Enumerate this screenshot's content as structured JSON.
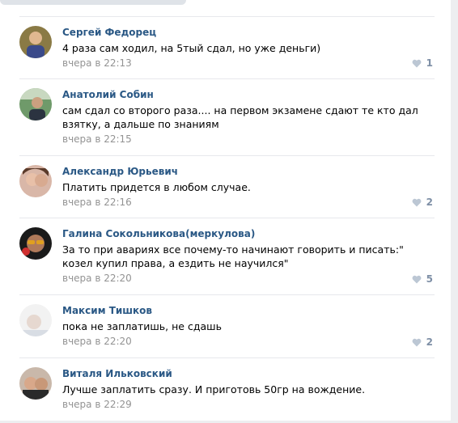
{
  "comments": [
    {
      "author": "Сергей Федорец",
      "text": "4 раза сам ходил, на 5тый сдал, но уже деньги)",
      "time": "вчера в 22:13",
      "likes": "1"
    },
    {
      "author": "Анатолий Собин",
      "text": "сам сдал со второго раза.... на первом экзамене сдают те кто дал взятку, а дальше по знаниям",
      "time": "вчера в 22:15",
      "likes": ""
    },
    {
      "author": "Александр Юрьевич",
      "text": "Платить придется в любом случае.",
      "time": "вчера в 22:16",
      "likes": "2"
    },
    {
      "author": "Галина Сокольникова(меркулова)",
      "text": "За то при авариях все почему-то начинают говорить и писать:\" козел купил права, а ездить не научился\"",
      "time": "вчера в 22:20",
      "likes": "5"
    },
    {
      "author": "Максим Тишков",
      "text": "пока не заплатишь, не сдашь",
      "time": "вчера в 22:20",
      "likes": "2"
    },
    {
      "author": "Виталя Ильковский",
      "text": "Лучше заплатить сразу. И приготовь 50гр на вождение.",
      "time": "вчера в 22:29",
      "likes": ""
    }
  ],
  "icons": {
    "like": "heart-icon",
    "avatar": "user-avatar"
  },
  "colors": {
    "author": "#2a5885",
    "meta": "#939393",
    "like": "#7e8fa6"
  }
}
